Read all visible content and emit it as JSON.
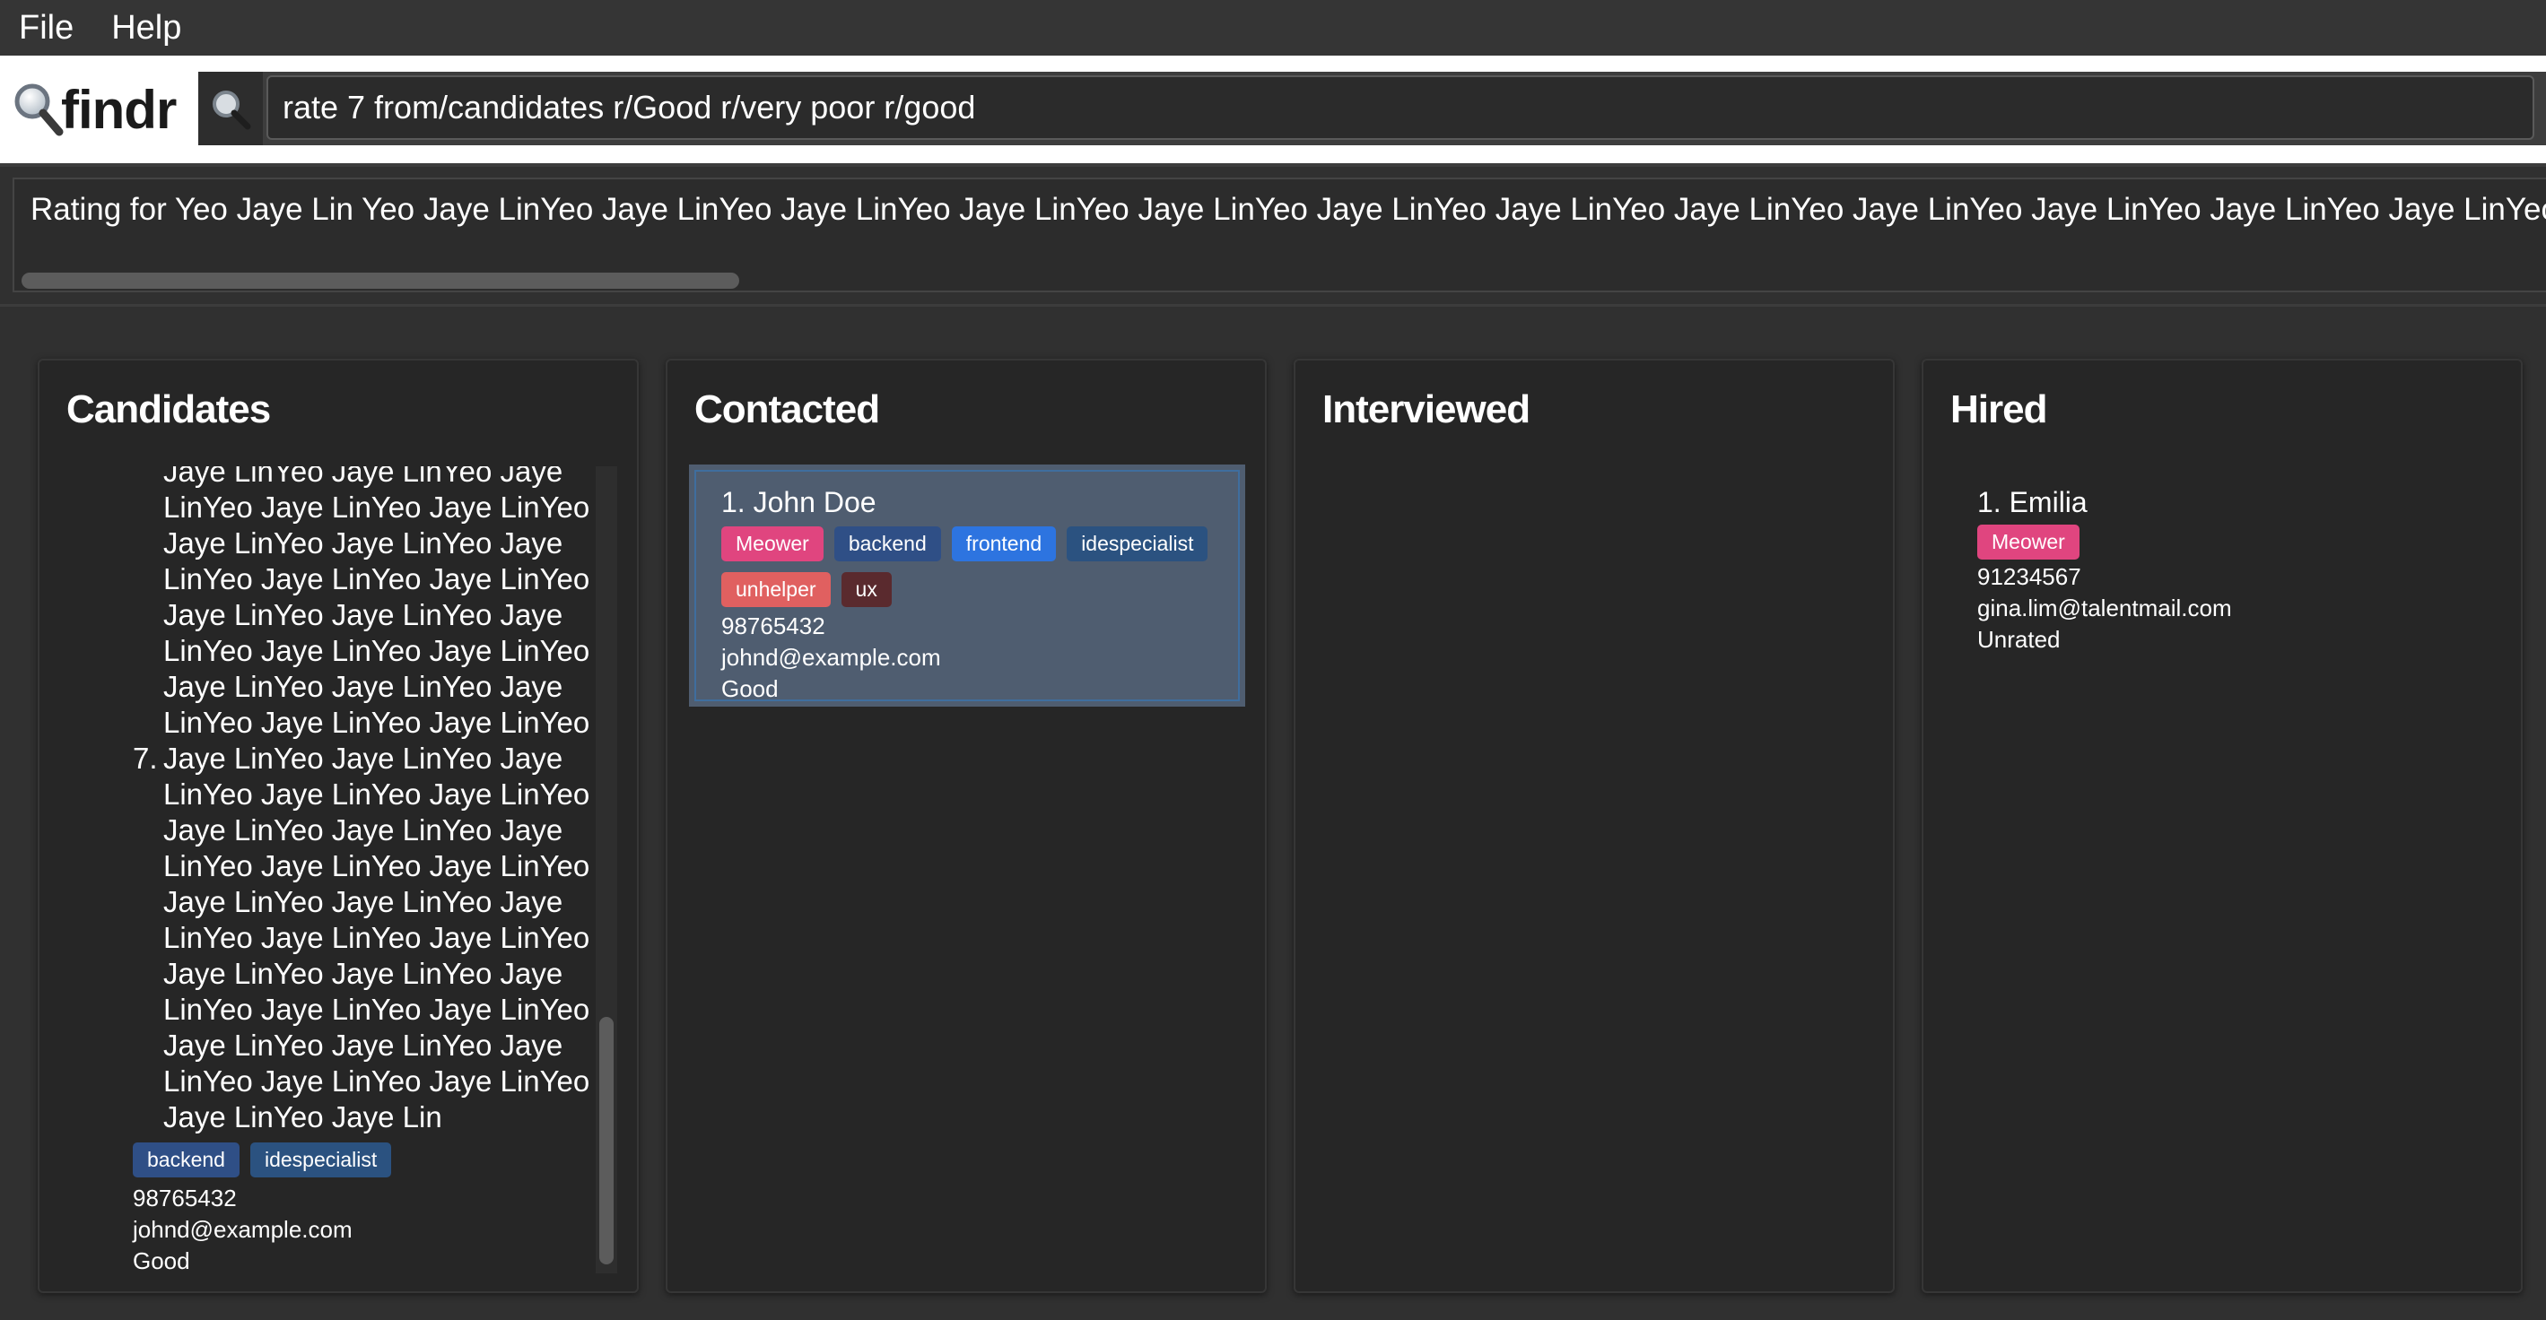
{
  "menu": {
    "items": [
      "File",
      "Help"
    ]
  },
  "app": {
    "logo_text": "findr"
  },
  "command": {
    "value": "rate 7 from/candidates r/Good r/very poor r/good"
  },
  "result": {
    "text": "Rating for Yeo Jaye Lin Yeo Jaye LinYeo Jaye LinYeo Jaye LinYeo Jaye LinYeo Jaye LinYeo Jaye LinYeo Jaye LinYeo Jaye LinYeo Jaye LinYeo Jaye LinYeo Jaye LinYeo Jaye LinYeo Jaye LinYeo Jaye LinYeo J"
  },
  "columns": {
    "candidates": {
      "title": "Candidates",
      "name_lines": [
        "Jaye LinYeo Jaye LinYeo Jaye",
        "LinYeo Jaye LinYeo Jaye LinYeo",
        "Jaye LinYeo Jaye LinYeo Jaye",
        "LinYeo Jaye LinYeo Jaye LinYeo",
        "Jaye LinYeo Jaye LinYeo Jaye",
        "LinYeo Jaye LinYeo Jaye LinYeo",
        "Jaye LinYeo Jaye LinYeo Jaye",
        "LinYeo Jaye LinYeo Jaye LinYeo"
      ],
      "card_index": "7.",
      "card_name_lines": [
        "Jaye LinYeo Jaye LinYeo Jaye",
        "LinYeo Jaye LinYeo Jaye LinYeo",
        "Jaye LinYeo Jaye LinYeo Jaye",
        "LinYeo Jaye LinYeo Jaye LinYeo",
        "Jaye LinYeo Jaye LinYeo Jaye",
        "LinYeo Jaye LinYeo Jaye LinYeo",
        "Jaye LinYeo Jaye LinYeo Jaye",
        "LinYeo Jaye LinYeo Jaye LinYeo",
        "Jaye LinYeo Jaye LinYeo Jaye",
        "LinYeo Jaye LinYeo Jaye LinYeo",
        "Jaye LinYeo Jaye Lin"
      ],
      "tags": [
        {
          "label": "backend",
          "color": "#2f4f86"
        },
        {
          "label": "idespecialist",
          "color": "#2b5280"
        }
      ],
      "phone": "98765432",
      "email": "johnd@example.com",
      "rating": "Good"
    },
    "contacted": {
      "title": "Contacted",
      "card": {
        "name": "1. John Doe",
        "tags": [
          {
            "label": "Meower",
            "color": "#e0457f"
          },
          {
            "label": "backend",
            "color": "#2f4f86"
          },
          {
            "label": "frontend",
            "color": "#2d74e0"
          },
          {
            "label": "idespecialist",
            "color": "#2b5280"
          },
          {
            "label": "unhelper",
            "color": "#e06060"
          },
          {
            "label": "ux",
            "color": "#5a2a2e"
          }
        ],
        "phone": "98765432",
        "email": "johnd@example.com",
        "rating": "Good"
      }
    },
    "interviewed": {
      "title": "Interviewed"
    },
    "hired": {
      "title": "Hired",
      "card": {
        "name": "1. Emilia",
        "tags": [
          {
            "label": "Meower",
            "color": "#e0457f"
          }
        ],
        "phone": "91234567",
        "email": "gina.lim@talentmail.com",
        "rating": "Unrated"
      }
    }
  }
}
